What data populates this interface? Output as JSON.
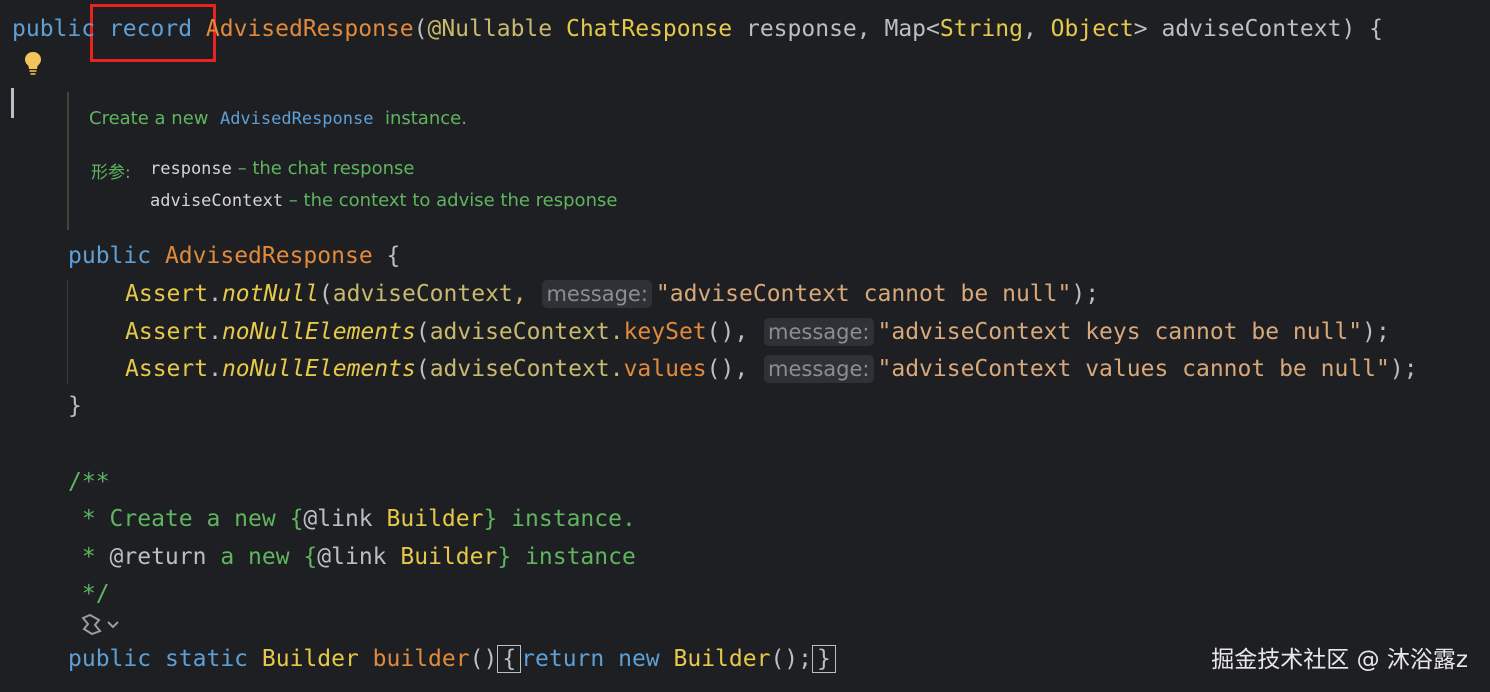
{
  "code": {
    "line1": {
      "kw_public": "public",
      "kw_record": "record",
      "class_name": "AdvisedResponse",
      "open": "(",
      "annotation": "@Nullable",
      "type1": "ChatResponse",
      "param1": " response, ",
      "map": "Map<",
      "type2": "String",
      "comma": ", ",
      "type3": "Object",
      "close_generic": "> ",
      "param2": "adviseContext",
      "tail": ") {"
    },
    "rendered_doc": {
      "create_prefix": "Create a new ",
      "create_link": "AdvisedResponse",
      "create_suffix": " instance.",
      "params_label": "形参:",
      "param1_name": "response",
      "param1_desc": " – the chat response",
      "param2_name": "adviseContext",
      "param2_desc": " – the context to advise the response"
    },
    "ctor": {
      "kw_public": "public",
      "name": "AdvisedResponse",
      "brace": " {"
    },
    "assert1": {
      "cls": "Assert",
      "dot": ".",
      "method": "notNull",
      "open": "(",
      "arg": "adviseContext, ",
      "hint": "message:",
      "str": "\"adviseContext cannot be null\"",
      "tail": ");"
    },
    "assert2": {
      "cls": "Assert",
      "dot": ".",
      "method": "noNullElements",
      "open": "(",
      "arg": "adviseContext.",
      "call": "keySet",
      "call_tail": "(), ",
      "hint": "message:",
      "str": "\"adviseContext keys cannot be null\"",
      "tail": ");"
    },
    "assert3": {
      "cls": "Assert",
      "dot": ".",
      "method": "noNullElements",
      "open": "(",
      "arg": "adviseContext.",
      "call": "values",
      "call_tail": "(), ",
      "hint": "message:",
      "str": "\"adviseContext values cannot be null\"",
      "tail": ");"
    },
    "close_brace": "}",
    "doc2": {
      "open": "/**",
      "l1_star": " * Create a new ",
      "l1_link_open": "{",
      "l1_tag": "@link",
      "l1_space": " ",
      "l1_cls": "Builder",
      "l1_link_close": "}",
      "l1_tail": " instance.",
      "l2_star": " * ",
      "l2_tag": "@return",
      "l2_mid": " a new ",
      "l2_link_open": "{",
      "l2_link_tag": "@link",
      "l2_space": " ",
      "l2_cls": "Builder",
      "l2_link_close": "}",
      "l2_tail": " instance",
      "close": " */"
    },
    "builder": {
      "kw_public": "public",
      "kw_static": " static ",
      "type": "Builder",
      "space": " ",
      "name": "builder",
      "parens": "()",
      "open_brace": "{",
      "kw_return": "return",
      "kw_new": " new ",
      "type2": "Builder",
      "tail": "();",
      "close_brace": "}"
    }
  },
  "watermark": "掘金技术社区 @ 沐浴露z",
  "colors": {
    "background": "#1e1f22",
    "keyword": "#5e9fd6",
    "class": "#e6c84a",
    "declaration": "#e08a3c",
    "doc": "#5fb55f",
    "highlight": "#e8231f"
  },
  "icons": [
    "lightbulb-icon",
    "fold-arrow-icon"
  ]
}
